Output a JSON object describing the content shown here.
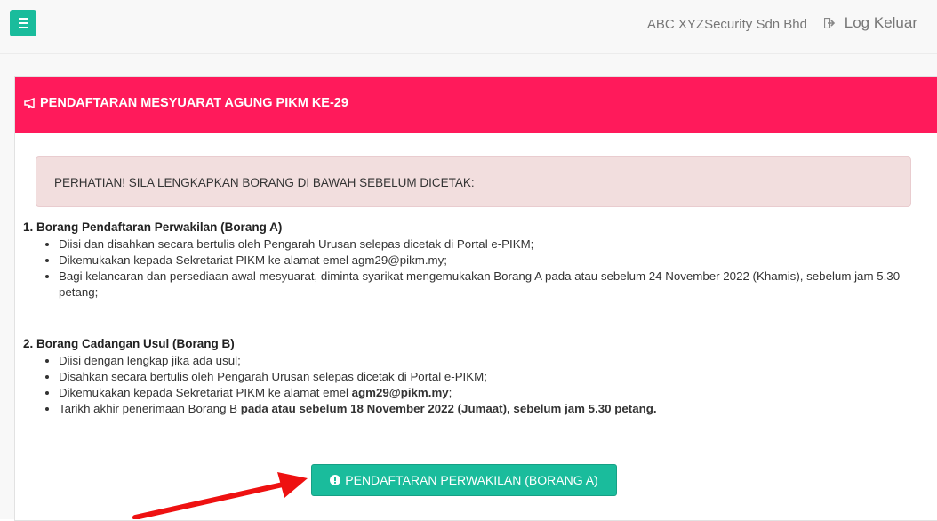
{
  "header": {
    "menu_icon": "hamburger-icon",
    "company": "ABC XYZSecurity Sdn Bhd",
    "logout_label": "Log Keluar",
    "logout_icon": "sign-out-icon",
    "accent_color": "#1abc9c"
  },
  "panel": {
    "title": "PENDAFTARAN MESYUARAT AGUNG PIKM KE-29",
    "title_icon": "bullhorn-icon",
    "header_color": "#ff1a5b",
    "alert": "PERHATIAN! SILA LENGKAPKAN BORANG DI BAWAH SEBELUM DICETAK:",
    "sections": [
      {
        "title": "1. Borang Pendaftaran Perwakilan (Borang A)",
        "items": [
          "Diisi dan disahkan secara bertulis oleh Pengarah Urusan selepas dicetak di Portal e-PIKM;",
          "Dikemukakan kepada Sekretariat PIKM ke alamat emel agm29@pikm.my;",
          "Bagi kelancaran dan persediaan awal mesyuarat, diminta syarikat mengemukakan Borang A pada atau sebelum 24 November 2022 (Khamis), sebelum jam 5.30 petang;"
        ]
      },
      {
        "title": "2. Borang Cadangan Usul (Borang B)",
        "items": [
          "Diisi dengan lengkap jika ada usul;",
          "Disahkan secara bertulis oleh Pengarah Urusan selepas dicetak di Portal e-PIKM;"
        ],
        "item3_prefix": "Dikemukakan kepada Sekretariat PIKM ke alamat emel ",
        "item3_email": "agm29@pikm.my",
        "item3_suffix": ";",
        "item4_prefix": "Tarikh akhir penerimaan Borang B ",
        "item4_bold": "pada atau sebelum 18 November 2022 (Jumaat), sebelum jam 5.30 petang."
      }
    ],
    "button_label": "PENDAFTARAN PERWAKILAN (BORANG A)",
    "button_icon": "exclamation-circle-icon"
  },
  "annotation": {
    "arrow_icon": "red-arrow-icon",
    "arrow_color": "#ee1111"
  }
}
